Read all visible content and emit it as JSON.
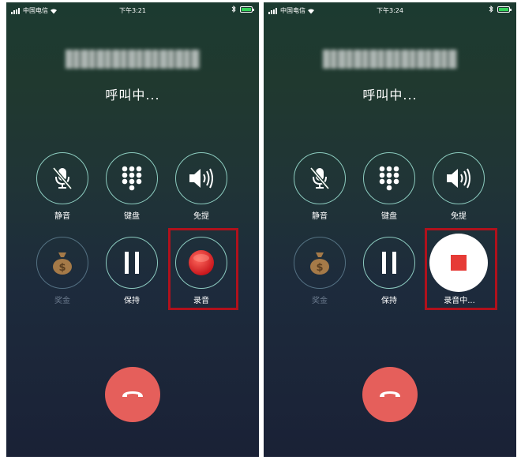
{
  "left": {
    "status_bar": {
      "carrier": "中国电信",
      "time": "下午3:21"
    },
    "call_status": "呼叫中...",
    "controls": {
      "mute_label": "静音",
      "keypad_label": "键盘",
      "speaker_label": "免提",
      "money_label": "奖金",
      "hold_label": "保持",
      "record_label": "录音"
    }
  },
  "right": {
    "status_bar": {
      "carrier": "中国电信",
      "time": "下午3:24"
    },
    "call_status": "呼叫中...",
    "controls": {
      "mute_label": "静音",
      "keypad_label": "键盘",
      "speaker_label": "免提",
      "money_label": "奖金",
      "hold_label": "保持",
      "recording_label": "录音中..."
    }
  },
  "colors": {
    "end_call": "#e55f5b",
    "record_dot": "#e12a2a",
    "stop_square": "#e63b36",
    "highlight": "#b0111c",
    "battery": "#34d058"
  },
  "icons": [
    "mic-muted-icon",
    "keypad-icon",
    "speaker-icon",
    "money-bag-icon",
    "pause-icon",
    "record-icon",
    "stop-icon",
    "phone-hangup-icon",
    "wifi-icon",
    "bluetooth-icon",
    "battery-icon",
    "signal-icon"
  ]
}
